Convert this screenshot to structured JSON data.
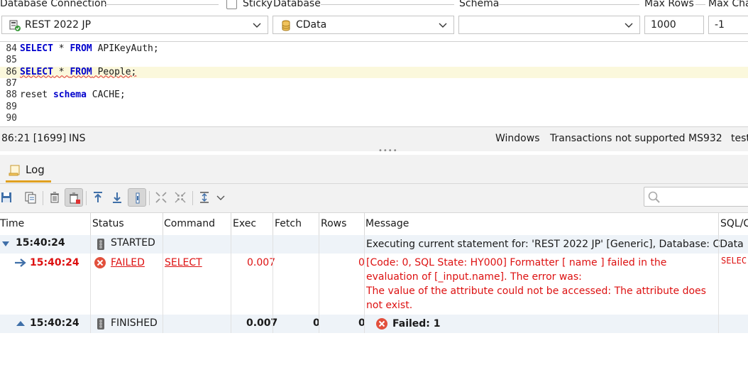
{
  "toolbar": {
    "db_connection_label": "Database Connection",
    "db_connection_value": "REST 2022 JP",
    "sticky_label": "Sticky",
    "database_label": "Database",
    "database_value": "CData",
    "schema_label": "Schema",
    "schema_value": "",
    "max_rows_label": "Max Rows",
    "max_rows_value": "1000",
    "max_chars_label": "Max Cha",
    "max_chars_value": "-1"
  },
  "editor": {
    "lines": [
      {
        "num": "84",
        "parts": [
          [
            "kw",
            "SELECT"
          ],
          [
            "t",
            " * "
          ],
          [
            "kw",
            "FROM"
          ],
          [
            "t",
            " APIKeyAuth;"
          ]
        ]
      },
      {
        "num": "85",
        "parts": []
      },
      {
        "num": "86",
        "parts": [
          [
            "kw",
            "SELECT"
          ],
          [
            "t",
            " * "
          ],
          [
            "kw",
            "FROM"
          ],
          [
            "t",
            " People;"
          ]
        ]
      },
      {
        "num": "87",
        "parts": []
      },
      {
        "num": "88",
        "parts": [
          [
            "t",
            "reset "
          ],
          [
            "kw",
            "schema"
          ],
          [
            "t",
            " CACHE;"
          ]
        ]
      },
      {
        "num": "89",
        "parts": []
      },
      {
        "num": "90",
        "parts": []
      }
    ]
  },
  "statusbar": {
    "position": "86:21 [1699]",
    "mode": "INS",
    "line_endings": "Windows",
    "transactions": "Transactions not supported",
    "encoding": "MS932",
    "extra": "test"
  },
  "log_tab": {
    "label": "Log"
  },
  "log_table": {
    "headers": {
      "time": "Time",
      "status": "Status",
      "command": "Command",
      "exec": "Exec",
      "fetch": "Fetch",
      "rows": "Rows",
      "message": "Message",
      "sql": "SQL/C"
    },
    "rows": [
      {
        "time": "15:40:24",
        "status": "STARTED",
        "command": "",
        "exec": "",
        "fetch": "",
        "rows": "",
        "message": "Executing current statement for: 'REST 2022 JP' [Generic], Database: CData",
        "sql": ""
      },
      {
        "time": "15:40:24",
        "status": "FAILED",
        "command": "SELECT",
        "exec": "0.007",
        "fetch": "",
        "rows": "0",
        "message": "[Code: 0, SQL State: HY000]  Formatter [ name ] failed in the evaluation of [_input.name]. The error was:",
        "message2": "The value of the attribute could not be accessed: The attribute does not exist.",
        "sql": "SELEC"
      },
      {
        "time": "15:40:24",
        "status": "FINISHED",
        "command": "",
        "exec": "0.007",
        "fetch": "0",
        "rows": "0",
        "message": "Failed: 1",
        "sql": ""
      }
    ]
  },
  "colors": {
    "error": "#dd1111",
    "keyword": "#0000cc",
    "row_alt": "#eef3f8",
    "current_line": "#fbf8dc"
  }
}
